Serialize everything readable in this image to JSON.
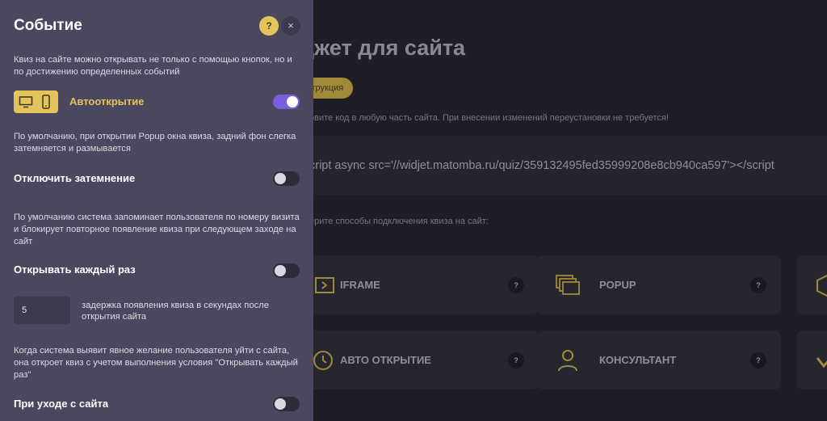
{
  "background": {
    "title": "джет для сайта",
    "instruction_button": "струкция",
    "description": "овите код в любую часть сайта. При внесении изменений переустановки не требуется!",
    "code_snippet": "cript async src='//widjet.matomba.ru/quiz/359132495fed35999208e8cb940ca597'></script",
    "choose_text": "ерите способы подключения квиза на сайт:",
    "cards": [
      {
        "label": "IFRAME",
        "icon": "iframe-icon",
        "help": "?"
      },
      {
        "label": "POPUP",
        "icon": "popup-windows-icon",
        "help": "?"
      },
      {
        "label": "АВТО ОТКРЫТИЕ",
        "icon": "clock-icon",
        "help": "?"
      },
      {
        "label": "КОНСУЛЬТАНТ",
        "icon": "person-icon",
        "help": "?"
      }
    ]
  },
  "panel": {
    "title": "Событие",
    "help_label": "?",
    "close_label": "×",
    "intro": "Квиз на сайте можно открывать не только с помощью кнопок, но и по достижению определенных событий",
    "auto_open_label": "Автооткрытие",
    "auto_open_on": true,
    "dim_desc": "По умолчанию, при открытии Popup окна квиза, задний фон слегка затемняется и размывается",
    "dim_label": "Отключить затемнение",
    "dim_on": false,
    "remember_desc": "По умолчанию система запоминает пользователя по номеру визита и блокирует повторное появление квиза при следующем заходе на сайт",
    "every_time_label": "Открывать каждый раз",
    "every_time_on": false,
    "delay_value": "5",
    "delay_desc": "задержка появления квиза в секундах после открытия сайта",
    "exit_desc": "Когда система выявит явное желание пользователя уйти с сайта, она откроет квиз с учетом выполнения условия \"Открывать каждый раз\"",
    "exit_label": "При уходе с сайта",
    "exit_on": false
  },
  "colors": {
    "accent": "#e4c35a",
    "toggle_on": "#7c5ce0",
    "panel_bg": "#4a475e",
    "page_bg": "#1f1e26"
  }
}
